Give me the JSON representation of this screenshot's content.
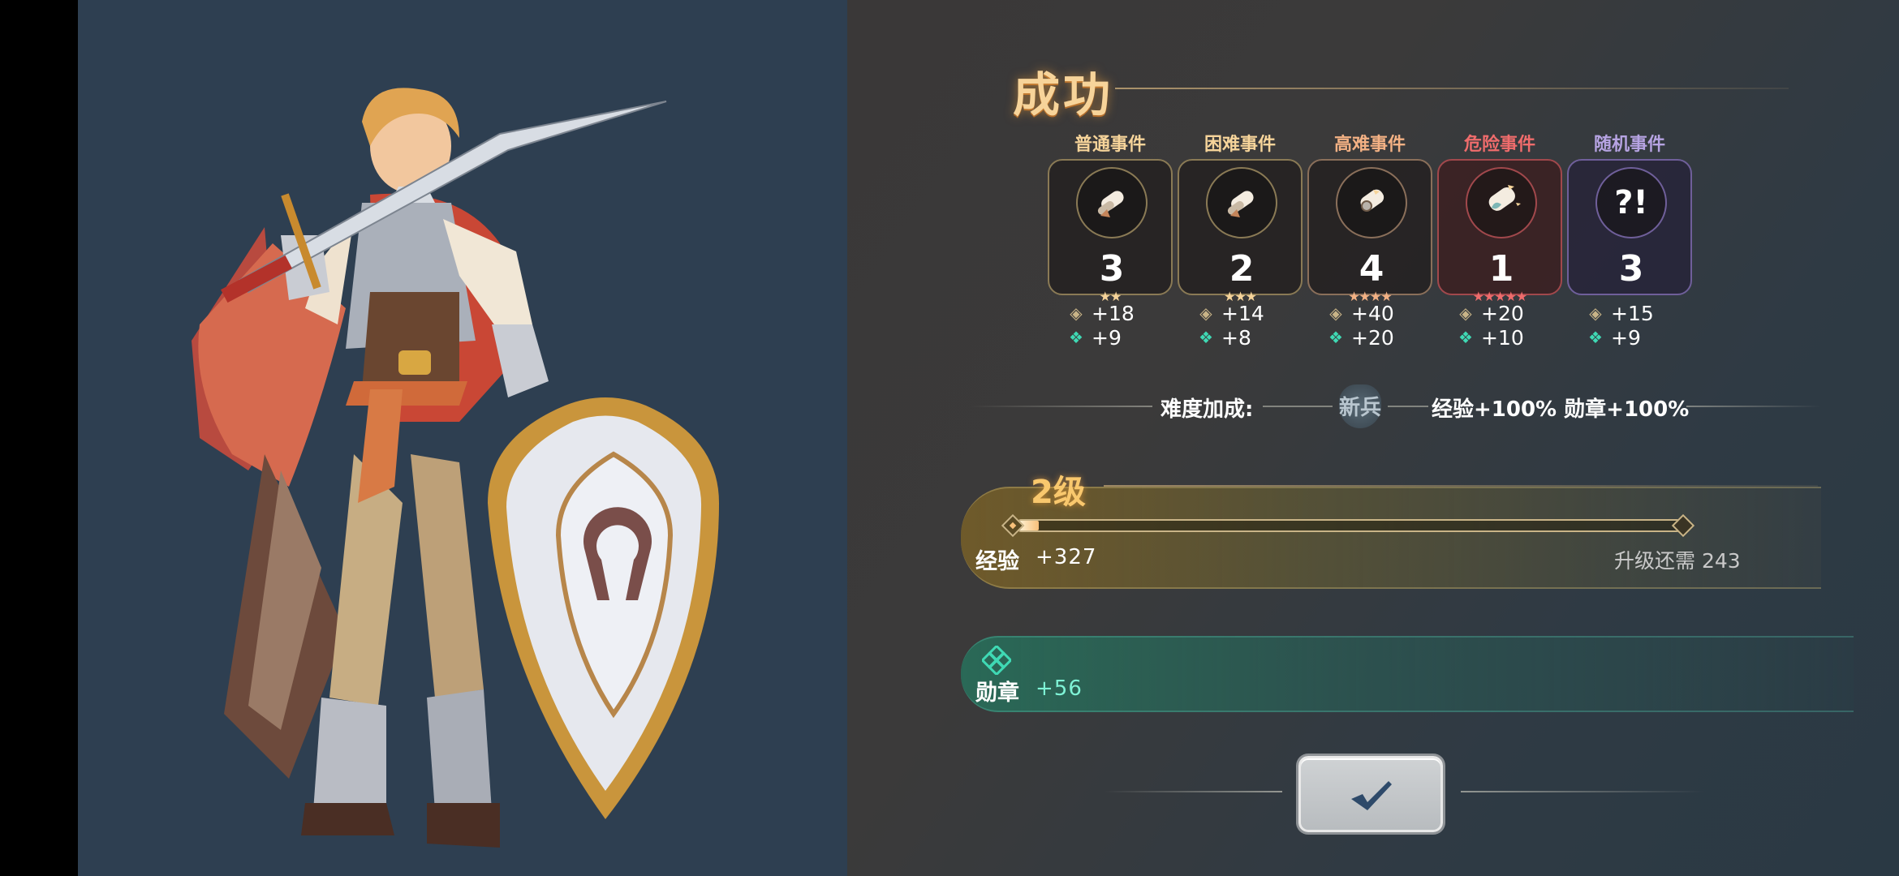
{
  "result": {
    "title": "成功",
    "events": [
      {
        "label": "普通事件",
        "count": "3",
        "stars": "★★",
        "xp": "+18",
        "medal": "+9",
        "color": "#f6d49a",
        "border": "#8a7a55",
        "icon": "scroll-icon"
      },
      {
        "label": "困难事件",
        "count": "2",
        "stars": "★★★",
        "xp": "+14",
        "medal": "+8",
        "color": "#f6d49a",
        "border": "#8a7a55",
        "icon": "scroll-icon"
      },
      {
        "label": "高难事件",
        "count": "4",
        "stars": "★★★★",
        "xp": "+40",
        "medal": "+20",
        "color": "#f3b184",
        "border": "#8a6f5a",
        "icon": "sealed-scroll-icon"
      },
      {
        "label": "危险事件",
        "count": "1",
        "stars": "★★★★★",
        "xp": "+20",
        "medal": "+10",
        "color": "#ef6c6c",
        "border": "#a1484c",
        "icon": "danger-scroll-icon"
      },
      {
        "label": "随机事件",
        "count": "3",
        "stars": "",
        "xp": "+15",
        "medal": "+9",
        "color": "#b6a3e2",
        "border": "#6f5f9a",
        "icon": "question-exclaim-icon"
      }
    ],
    "difficulty": {
      "label": "难度加成:",
      "rank": "新兵",
      "bonus": "经验+100% 勋章+100%"
    },
    "level": {
      "label": "2级",
      "xp_name": "经验",
      "xp_gain": "+327",
      "remaining": "升级还需 243",
      "progress": 0.03
    },
    "medal": {
      "name": "勋章",
      "gain": "+56"
    },
    "confirm_icon": "check-icon",
    "colors": {
      "gold": "#f9c86d",
      "teal": "#3fd9b4",
      "hero_bg": "#2e3f51"
    }
  }
}
